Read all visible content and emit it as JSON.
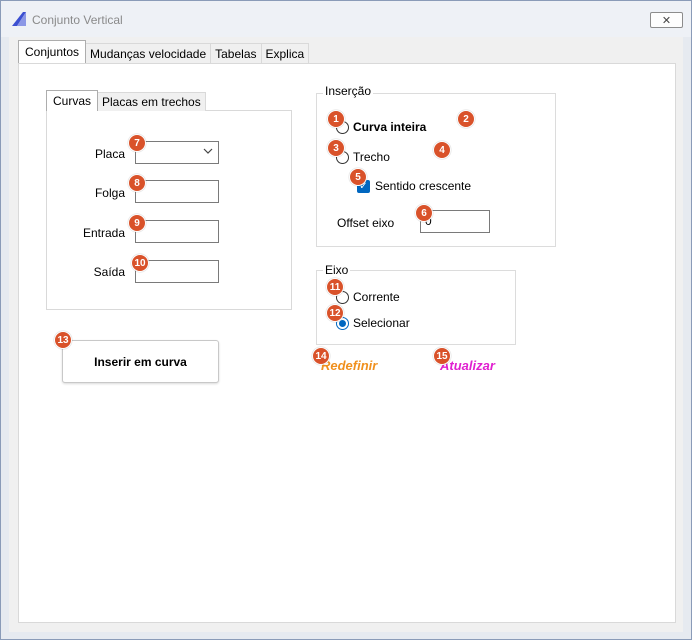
{
  "window": {
    "title": "Conjunto Vertical",
    "close_glyph": "✕"
  },
  "tabs": [
    {
      "label": "Conjuntos"
    },
    {
      "label": "Mudanças velocidade"
    },
    {
      "label": "Tabelas"
    },
    {
      "label": "Explica"
    }
  ],
  "subtabs": [
    {
      "label": "Curvas"
    },
    {
      "label": "Placas em trechos"
    }
  ],
  "fields": {
    "placa": {
      "label": "Placa",
      "value": ""
    },
    "folga": {
      "label": "Folga",
      "value": ""
    },
    "entrada": {
      "label": "Entrada",
      "value": ""
    },
    "saida": {
      "label": "Saída",
      "value": ""
    }
  },
  "insercao": {
    "title": "Inserção",
    "curva_inteira": "Curva inteira",
    "trecho": "Trecho",
    "sentido_crescente": "Sentido crescente",
    "offset_label": "Offset eixo",
    "offset_value": "0"
  },
  "eixo": {
    "title": "Eixo",
    "corrente": "Corrente",
    "selecionar": "Selecionar"
  },
  "buttons": {
    "inserir": "Inserir em curva"
  },
  "links": {
    "redefinir": "Redefinir",
    "atualizar": "Atualizar"
  },
  "badges": [
    "1",
    "2",
    "3",
    "4",
    "5",
    "6",
    "7",
    "8",
    "9",
    "10",
    "11",
    "12",
    "13",
    "14",
    "15"
  ],
  "colors": {
    "badge": "#d9522a",
    "accent": "#0067c0",
    "redefinir": "#f0901e",
    "atualizar": "#e020d0"
  }
}
